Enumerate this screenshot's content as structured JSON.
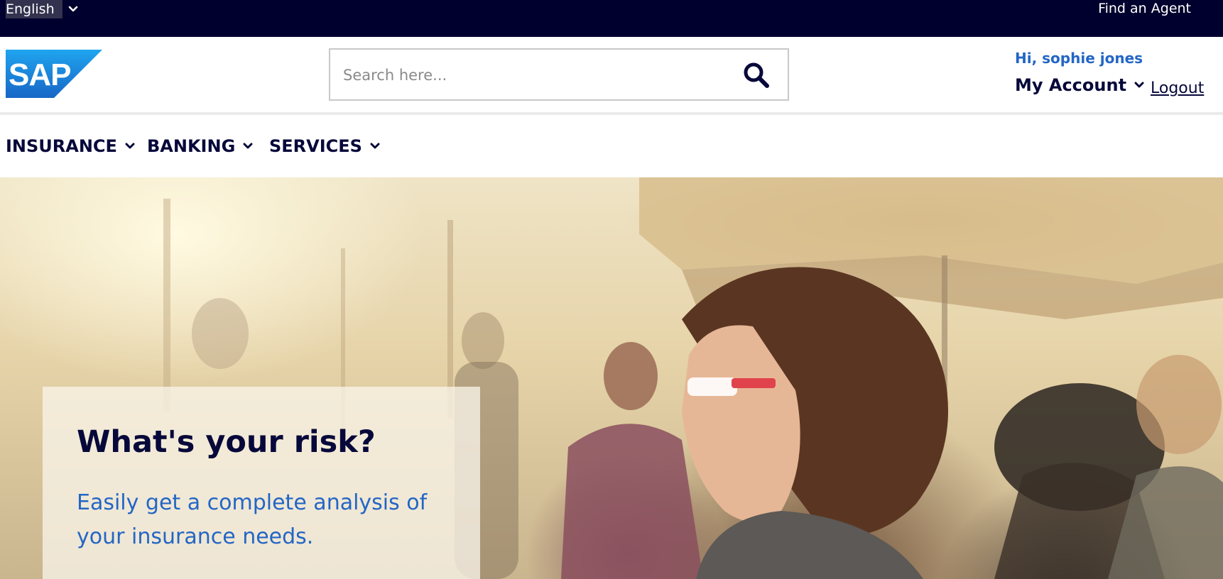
{
  "topbar": {
    "language": "English",
    "find_agent": "Find an Agent"
  },
  "header": {
    "logo_text": "SAP",
    "search": {
      "placeholder": "Search here...",
      "value": ""
    },
    "greeting": "Hi, sophie jones",
    "my_account": "My Account",
    "logout": "Logout"
  },
  "nav": {
    "items": [
      {
        "label": "INSURANCE"
      },
      {
        "label": "BANKING"
      },
      {
        "label": "SERVICES"
      }
    ]
  },
  "hero": {
    "title": "What's your risk?",
    "subtitle": "Easily get a complete analysis of your insurance needs."
  },
  "colors": {
    "topbar_bg": "#00002e",
    "brand_blue": "#2366c5",
    "text_dark": "#07083a"
  },
  "icons": {
    "search": "search-icon",
    "chevron": "chevron-down-icon",
    "logo": "sap-logo"
  }
}
